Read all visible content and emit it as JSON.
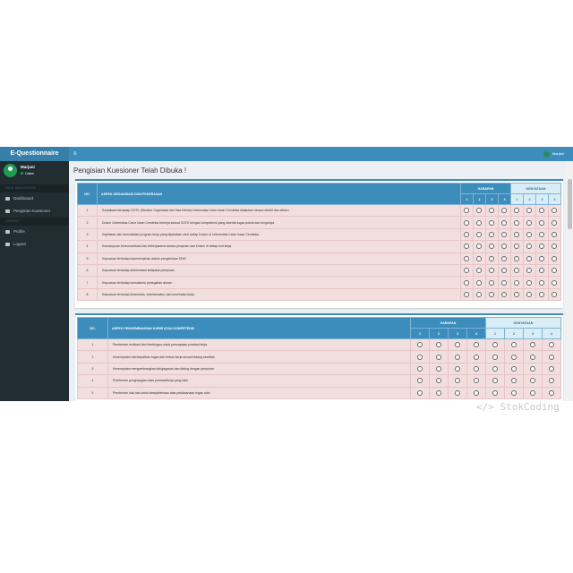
{
  "app": {
    "title": "E-Questionnaire"
  },
  "navbar": {
    "menu_icon": "≡",
    "user": "Marjani"
  },
  "sidebar": {
    "user": {
      "name": "Marjani",
      "status": "Online"
    },
    "sections": [
      {
        "header": "MAIN NAVIGATION",
        "items": [
          {
            "label": "Dashboard",
            "icon": "dashboard-icon"
          },
          {
            "label": "Pengisian Kuesioner",
            "icon": "edit-icon"
          }
        ]
      },
      {
        "header": "LOGOUT",
        "items": [
          {
            "label": "Profile",
            "icon": "user-icon"
          },
          {
            "label": "Logout",
            "icon": "logout-icon"
          }
        ]
      }
    ]
  },
  "page": {
    "title": "Pengisian Kuesioner Telah Dibuka !"
  },
  "table1": {
    "no_header": "NO.",
    "aspect_header": "ASPEK ORGANISASI DAN PEKERJAAN",
    "harapan": "HARAPAN",
    "kenyataan": "KENYATAAN",
    "scale": [
      "1",
      "2",
      "3",
      "4"
    ],
    "rows": [
      {
        "no": "1",
        "text": "Sosialisasi terhadap SOTK (Struktur Organisasi dan Tata Kelola) Universitas Catur Insan Cendekia dilakukan secara efektif dan efisien"
      },
      {
        "no": "2",
        "text": "Dosen Universitas Catur Insan Cendekia bekerja sesuai SOTK dengan kompetensi yang disertai tugas pokok dan fungsinya"
      },
      {
        "no": "3",
        "text": "Kejelasan dan kemudahan program kerja yang dijalankan oleh setiap Dosen di Universitas Catur Insan Cendekia"
      },
      {
        "no": "4",
        "text": "Kemampuan berkomunikasi dan bekerjasama antara pimpinan dan Dosen di setiap unit kerja"
      },
      {
        "no": "5",
        "text": "Kepuasan terhadap kepemimpinan dalam pengelolaan SDM"
      },
      {
        "no": "6",
        "text": "Kepuasan terhadap sinkronisasi kebijakan pimpinan"
      },
      {
        "no": "7",
        "text": "Kepuasan terhadap konsistensi penegakan aturan"
      },
      {
        "no": "8",
        "text": "Kepuasan terhadap keamanan, keselamatan, dan kesehatan kerja"
      }
    ]
  },
  "table2": {
    "no_header": "NO.",
    "aspect_header": "ASPEK PENGEMBANGAN KARIR ATAU KOMPETENSI",
    "harapan": "HARAPAN",
    "kenyataan": "KENYATAAN",
    "scale": [
      "1",
      "2",
      "3",
      "4"
    ],
    "rows": [
      {
        "no": "1",
        "text": "Pemberian motivasi dan bimbingan untuk pencapaian prestasi kerja"
      },
      {
        "no": "2",
        "text": "Kesempatan mendapatkan tugas dan beban kerja sesuai bidang keahlian"
      },
      {
        "no": "3",
        "text": "Kesempatan mengembangkan ide/gagasan dan dialog dengan pimpinan"
      },
      {
        "no": "4",
        "text": "Pemberian penghargaan atas prestasi/kerja yang baik"
      },
      {
        "no": "5",
        "text": "Pemberian hak-hak untuk kesejahteraan atas pelaksanaan tugas rutin"
      }
    ]
  },
  "watermark": "</> StokCoding"
}
